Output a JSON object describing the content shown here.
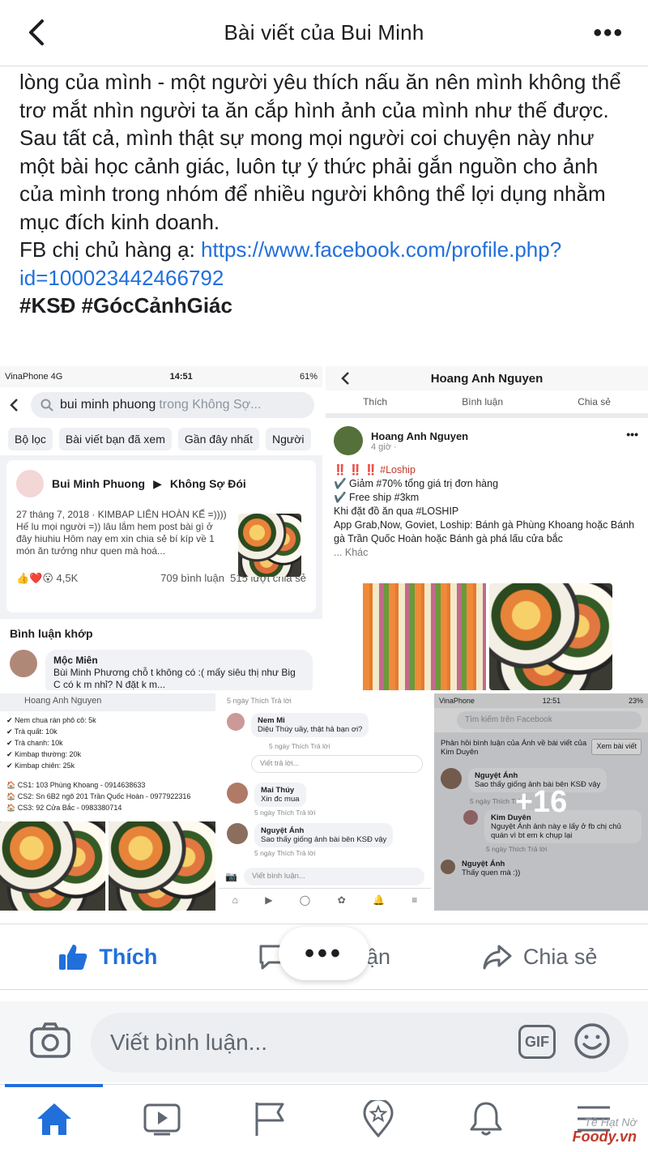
{
  "header": {
    "title": "Bài viết của Bui Minh",
    "back_label": "",
    "more_label": "•••"
  },
  "post": {
    "lines": [
      "lòng của mình - một người yêu thích nấu ăn nên mình không thể trơ mắt nhìn người ta ăn cắp hình ảnh của mình như thế được.",
      "Sau tất cả, mình thật sự mong mọi người coi chuyện này như một bài học cảnh giác, luôn tự ý thức phải gắn nguồn cho ảnh của mình trong nhóm để nhiều người không thể lợi dụng nhằm mục đích kinh doanh."
    ],
    "fb_prefix": "FB chị chủ hàng ạ: ",
    "fb_link": "https://www.facebook.com/profile.php?id=100023442466792",
    "hashtags": "#KSĐ #GócCảnhGiác"
  },
  "tile1": {
    "carrier": "VinaPhone  4G",
    "time": "14:51",
    "battery": "61%",
    "search_query": "bui minh phuong",
    "search_hint": "trong Không Sợ...",
    "chips": [
      "Bộ lọc",
      "Bài viết bạn đã xem",
      "Gần đây nhất",
      "Người"
    ],
    "author": "Bui Minh Phuong",
    "group": "Không Sợ Đói",
    "date_line": "27 tháng 7, 2018 · KIMBAP LIÊN HOÀN KẾ =)))) Hế lu mọi người =)) lâu lắm hem post bài gì ở đây hiuhiu Hôm nay em xin chia sẻ bí kíp về 1 món ăn tưởng như quen mà hoá...",
    "reactions": "4,5K",
    "comments": "709 bình luận",
    "shares": "515 lượt chia sẻ",
    "match_label": "Bình luận khớp",
    "commenter": "Mộc Miên",
    "comment": "Bùi Minh Phương chỗ t không có :( mấy siêu thị như Big C có k m nhỉ? N đặt k m..."
  },
  "tile2": {
    "title": "Hoang Anh Nguyen",
    "actions": [
      "Thích",
      "Bình luận",
      "Chia sẻ"
    ],
    "author": "Hoang Anh Nguyen",
    "time": "4 giờ ·",
    "l1": "‼️ ‼️ ‼️ #Loship",
    "l2": "✔️ Giảm #70% tổng giá trị đơn hàng",
    "l3": "✔️ Free ship #3km",
    "l4": "Khi đặt đồ ăn qua #LOSHIP",
    "l5": "App Grab,Now, Goviet, Loship: Bánh gà Phùng Khoang hoặc Bánh gà Trần Quốc Hoàn hoặc Bánh gà phá lấu cửa bắc",
    "more": "... Khác"
  },
  "tile3": {
    "search": "Hoang Anh Nguyen",
    "menu": [
      "Nem chua rán phô cô: 5k",
      "Trà quất: 10k",
      "Trà chanh: 10k",
      "Kimbap thường: 20k",
      "Kimbap chiên: 25k"
    ],
    "stores": [
      "CS1: 103 Phùng Khoang - 0914638633",
      "CS2: Sn 6B2 ngõ 201 Trần Quốc Hoàn - 0977922316",
      "CS3: 92 Cửa Bắc - 0983380714"
    ]
  },
  "tile4": {
    "meta_top": "5 ngày   Thích   Trả lời",
    "c1_name": "Nem Mi",
    "c1_text": "Diệu Thúy uầy, thật hả bạn ơi?",
    "reply_hint": "Viết trả lời...",
    "c2_name": "Mai Thúy",
    "c2_text": "Xin đc mua",
    "c3_name": "Nguyệt Ánh",
    "c3_text": "Sao thấy giống ảnh bài bên KSĐ vậy",
    "meta": "5 ngày   Thích   Trả lời",
    "input": "Viết bình luận..."
  },
  "tile5": {
    "carrier": "VinaPhone",
    "time": "12:51",
    "battery": "23%",
    "search_hint": "Tìm kiếm trên Facebook",
    "notice": "Phản hồi bình luận của Ánh về bài viết của Kim Duyên",
    "view_post": "Xem bài viết",
    "r1_name": "Nguyệt Ánh",
    "r1_text": "Sao thấy giống ảnh bài bên KSĐ vậy",
    "r2_name": "Kim Duyên",
    "r2_text": "Nguyệt Ánh ảnh này e lấy ở fb chị chủ quán vì bt em k chụp lại",
    "r3_name": "Nguyệt Ánh",
    "r3_text": "Thấy quen mà :))",
    "meta": "5 ngày   Thích   Trả lời",
    "overlay": "+16"
  },
  "actions": {
    "like": "Thích",
    "comment": "Bình luận",
    "share": "Chia sẻ",
    "more": "•••"
  },
  "composer": {
    "placeholder": "Viết bình luận...",
    "gif": "GIF"
  },
  "watermark": {
    "text": "Tề Hạt Nờ",
    "brand": "Foody.vn"
  },
  "colors": {
    "accent": "#216fdb",
    "text": "#1c1e21",
    "muted": "#606770"
  }
}
